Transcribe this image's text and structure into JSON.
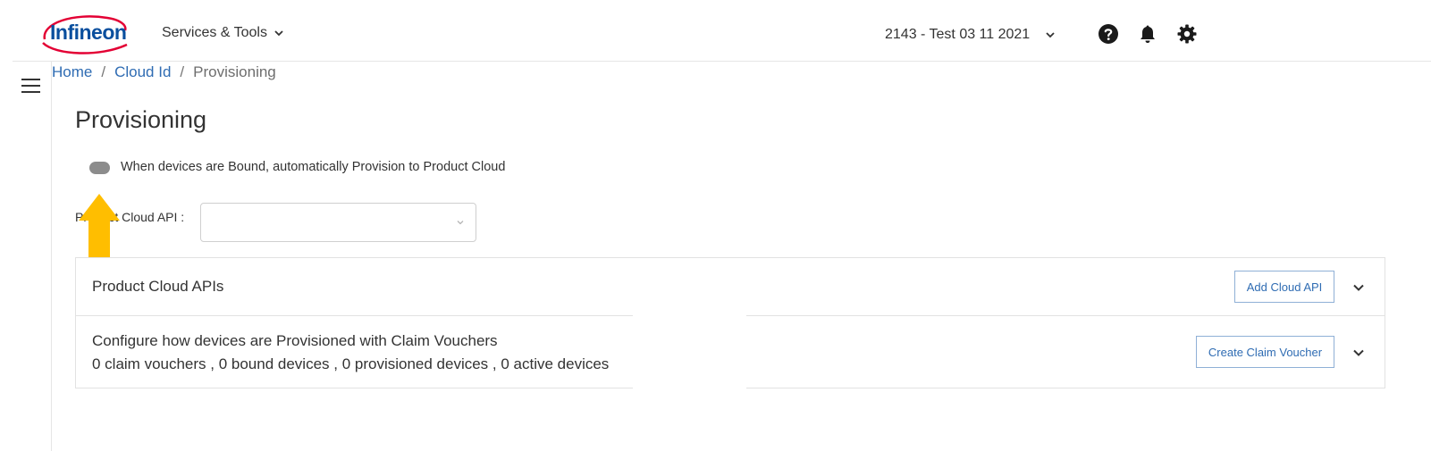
{
  "header": {
    "logo_text": "Infineon",
    "services_menu_label": "Services & Tools",
    "tenant_label": "2143 - Test 03 11 2021",
    "icons": [
      "help-icon",
      "bell-icon",
      "gear-icon"
    ]
  },
  "breadcrumb": {
    "home": "Home",
    "separator": "/",
    "cloud_id": "Cloud Id",
    "current": "Provisioning"
  },
  "page": {
    "title": "Provisioning",
    "toggle_label": "When devices are Bound, automatically Provision to Product Cloud",
    "toggle_on": false,
    "api_label": "Product Cloud API :",
    "api_value": ""
  },
  "panels": {
    "cloud_apis": {
      "title": "Product Cloud APIs",
      "button": "Add Cloud API"
    },
    "claim_vouchers": {
      "title": "Configure how devices are Provisioned with Claim Vouchers",
      "summary": "0 claim vouchers , 0 bound devices , 0 provisioned devices , 0 active devices",
      "button": "Create Claim Voucher"
    }
  },
  "colors": {
    "brand_blue": "#0a4f9e",
    "brand_red": "#e30034",
    "link_blue": "#2f6cb3",
    "annotation_arrow": "#ffbe00"
  }
}
